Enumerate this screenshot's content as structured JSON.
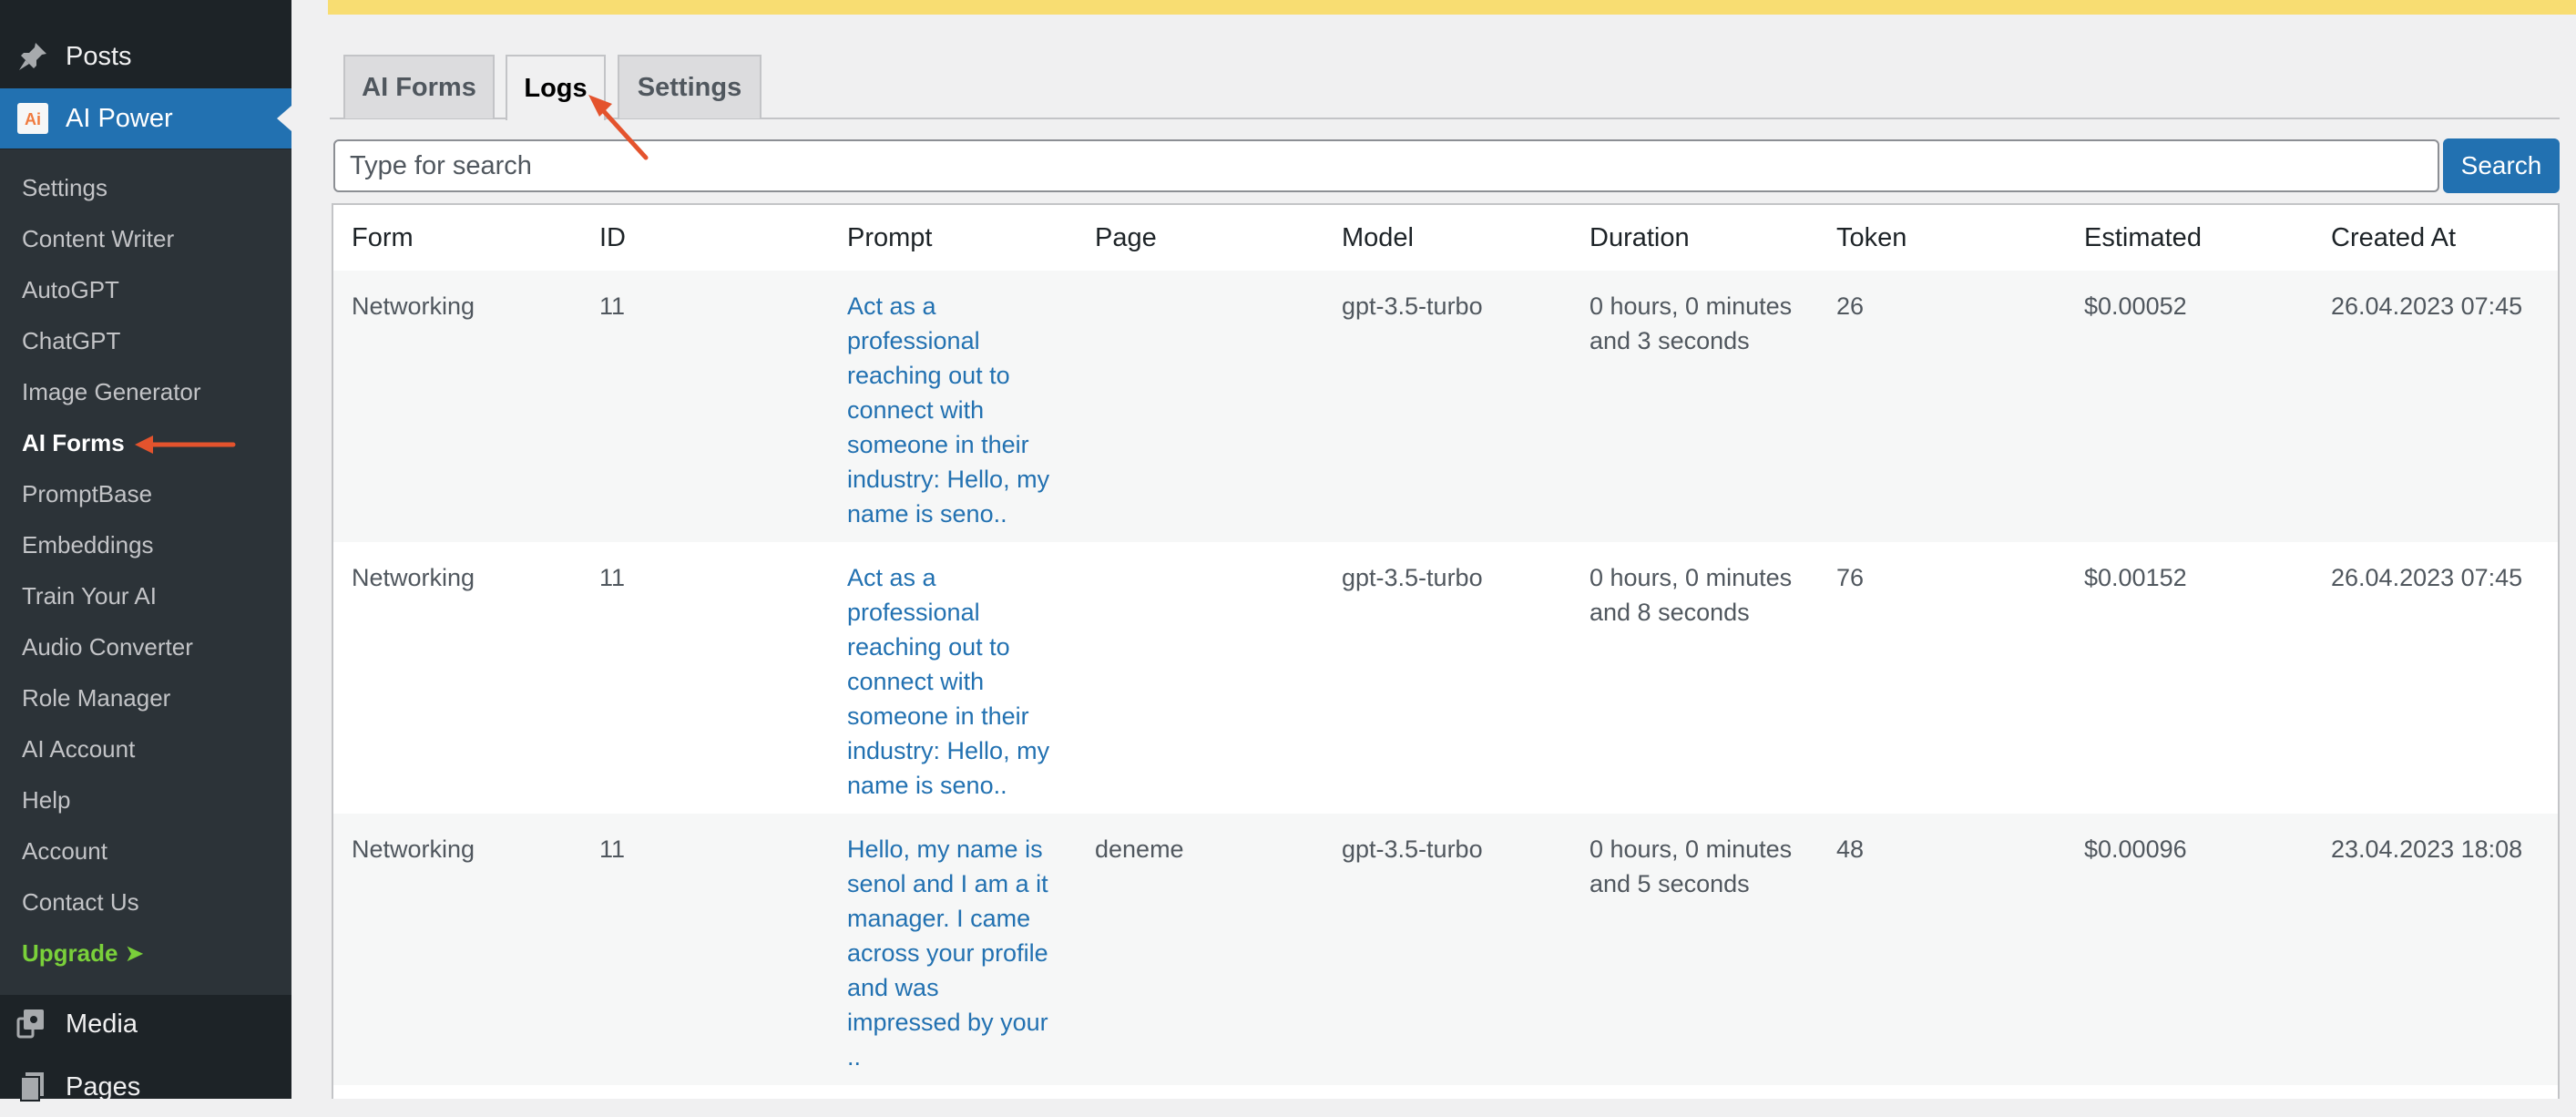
{
  "sidebar": {
    "top_items": [
      {
        "label": "Posts",
        "icon": "pin-icon"
      },
      {
        "label": "AI Power",
        "icon": "ai-power-logo-icon"
      },
      {
        "label": "Media",
        "icon": "media-icon"
      },
      {
        "label": "Pages",
        "icon": "pages-icon"
      }
    ],
    "submenu": [
      "Settings",
      "Content Writer",
      "AutoGPT",
      "ChatGPT",
      "Image Generator",
      "AI Forms",
      "PromptBase",
      "Embeddings",
      "Train Your AI",
      "Audio Converter",
      "Role Manager",
      "AI Account",
      "Help",
      "Account",
      "Contact Us",
      "Upgrade ➤"
    ],
    "logo_text": "Ai"
  },
  "tabs": [
    "AI Forms",
    "Logs",
    "Settings"
  ],
  "search": {
    "placeholder": "Type for search",
    "button": "Search"
  },
  "table": {
    "headers": [
      "Form",
      "ID",
      "Prompt",
      "Page",
      "Model",
      "Duration",
      "Token",
      "Estimated",
      "Created At"
    ],
    "rows": [
      {
        "form": "Networking",
        "id": "11",
        "prompt_lines": [
          "Act as a",
          "professional",
          "reaching out to",
          "connect with",
          "someone in their",
          "industry: Hello, my",
          "name is seno.."
        ],
        "page": "",
        "model": "gpt-3.5-turbo",
        "duration_lines": [
          "0 hours, 0 minutes",
          "and 3 seconds"
        ],
        "token": "26",
        "estimated": "$0.00052",
        "created_at": "26.04.2023 07:45"
      },
      {
        "form": "Networking",
        "id": "11",
        "prompt_lines": [
          "Act as a",
          "professional",
          "reaching out to",
          "connect with",
          "someone in their",
          "industry: Hello, my",
          "name is seno.."
        ],
        "page": "",
        "model": "gpt-3.5-turbo",
        "duration_lines": [
          "0 hours, 0 minutes",
          "and 8 seconds"
        ],
        "token": "76",
        "estimated": "$0.00152",
        "created_at": "26.04.2023 07:45"
      },
      {
        "form": "Networking",
        "id": "11",
        "prompt_lines": [
          "Hello, my name is",
          "senol and I am a it",
          "manager. I came",
          "across your profile",
          "and was",
          "impressed by your",
          ".."
        ],
        "page": "deneme",
        "model": "gpt-3.5-turbo",
        "duration_lines": [
          "0 hours, 0 minutes",
          "and 5 seconds"
        ],
        "token": "48",
        "estimated": "$0.00096",
        "created_at": "23.04.2023 18:08"
      }
    ]
  },
  "colors": {
    "sidebar_bg": "#1d2327",
    "submenu_bg": "#2c3338",
    "accent": "#2271b1",
    "notice": "#f8dd72",
    "upgrade": "#7ad03a",
    "arrow": "#e4532d"
  }
}
